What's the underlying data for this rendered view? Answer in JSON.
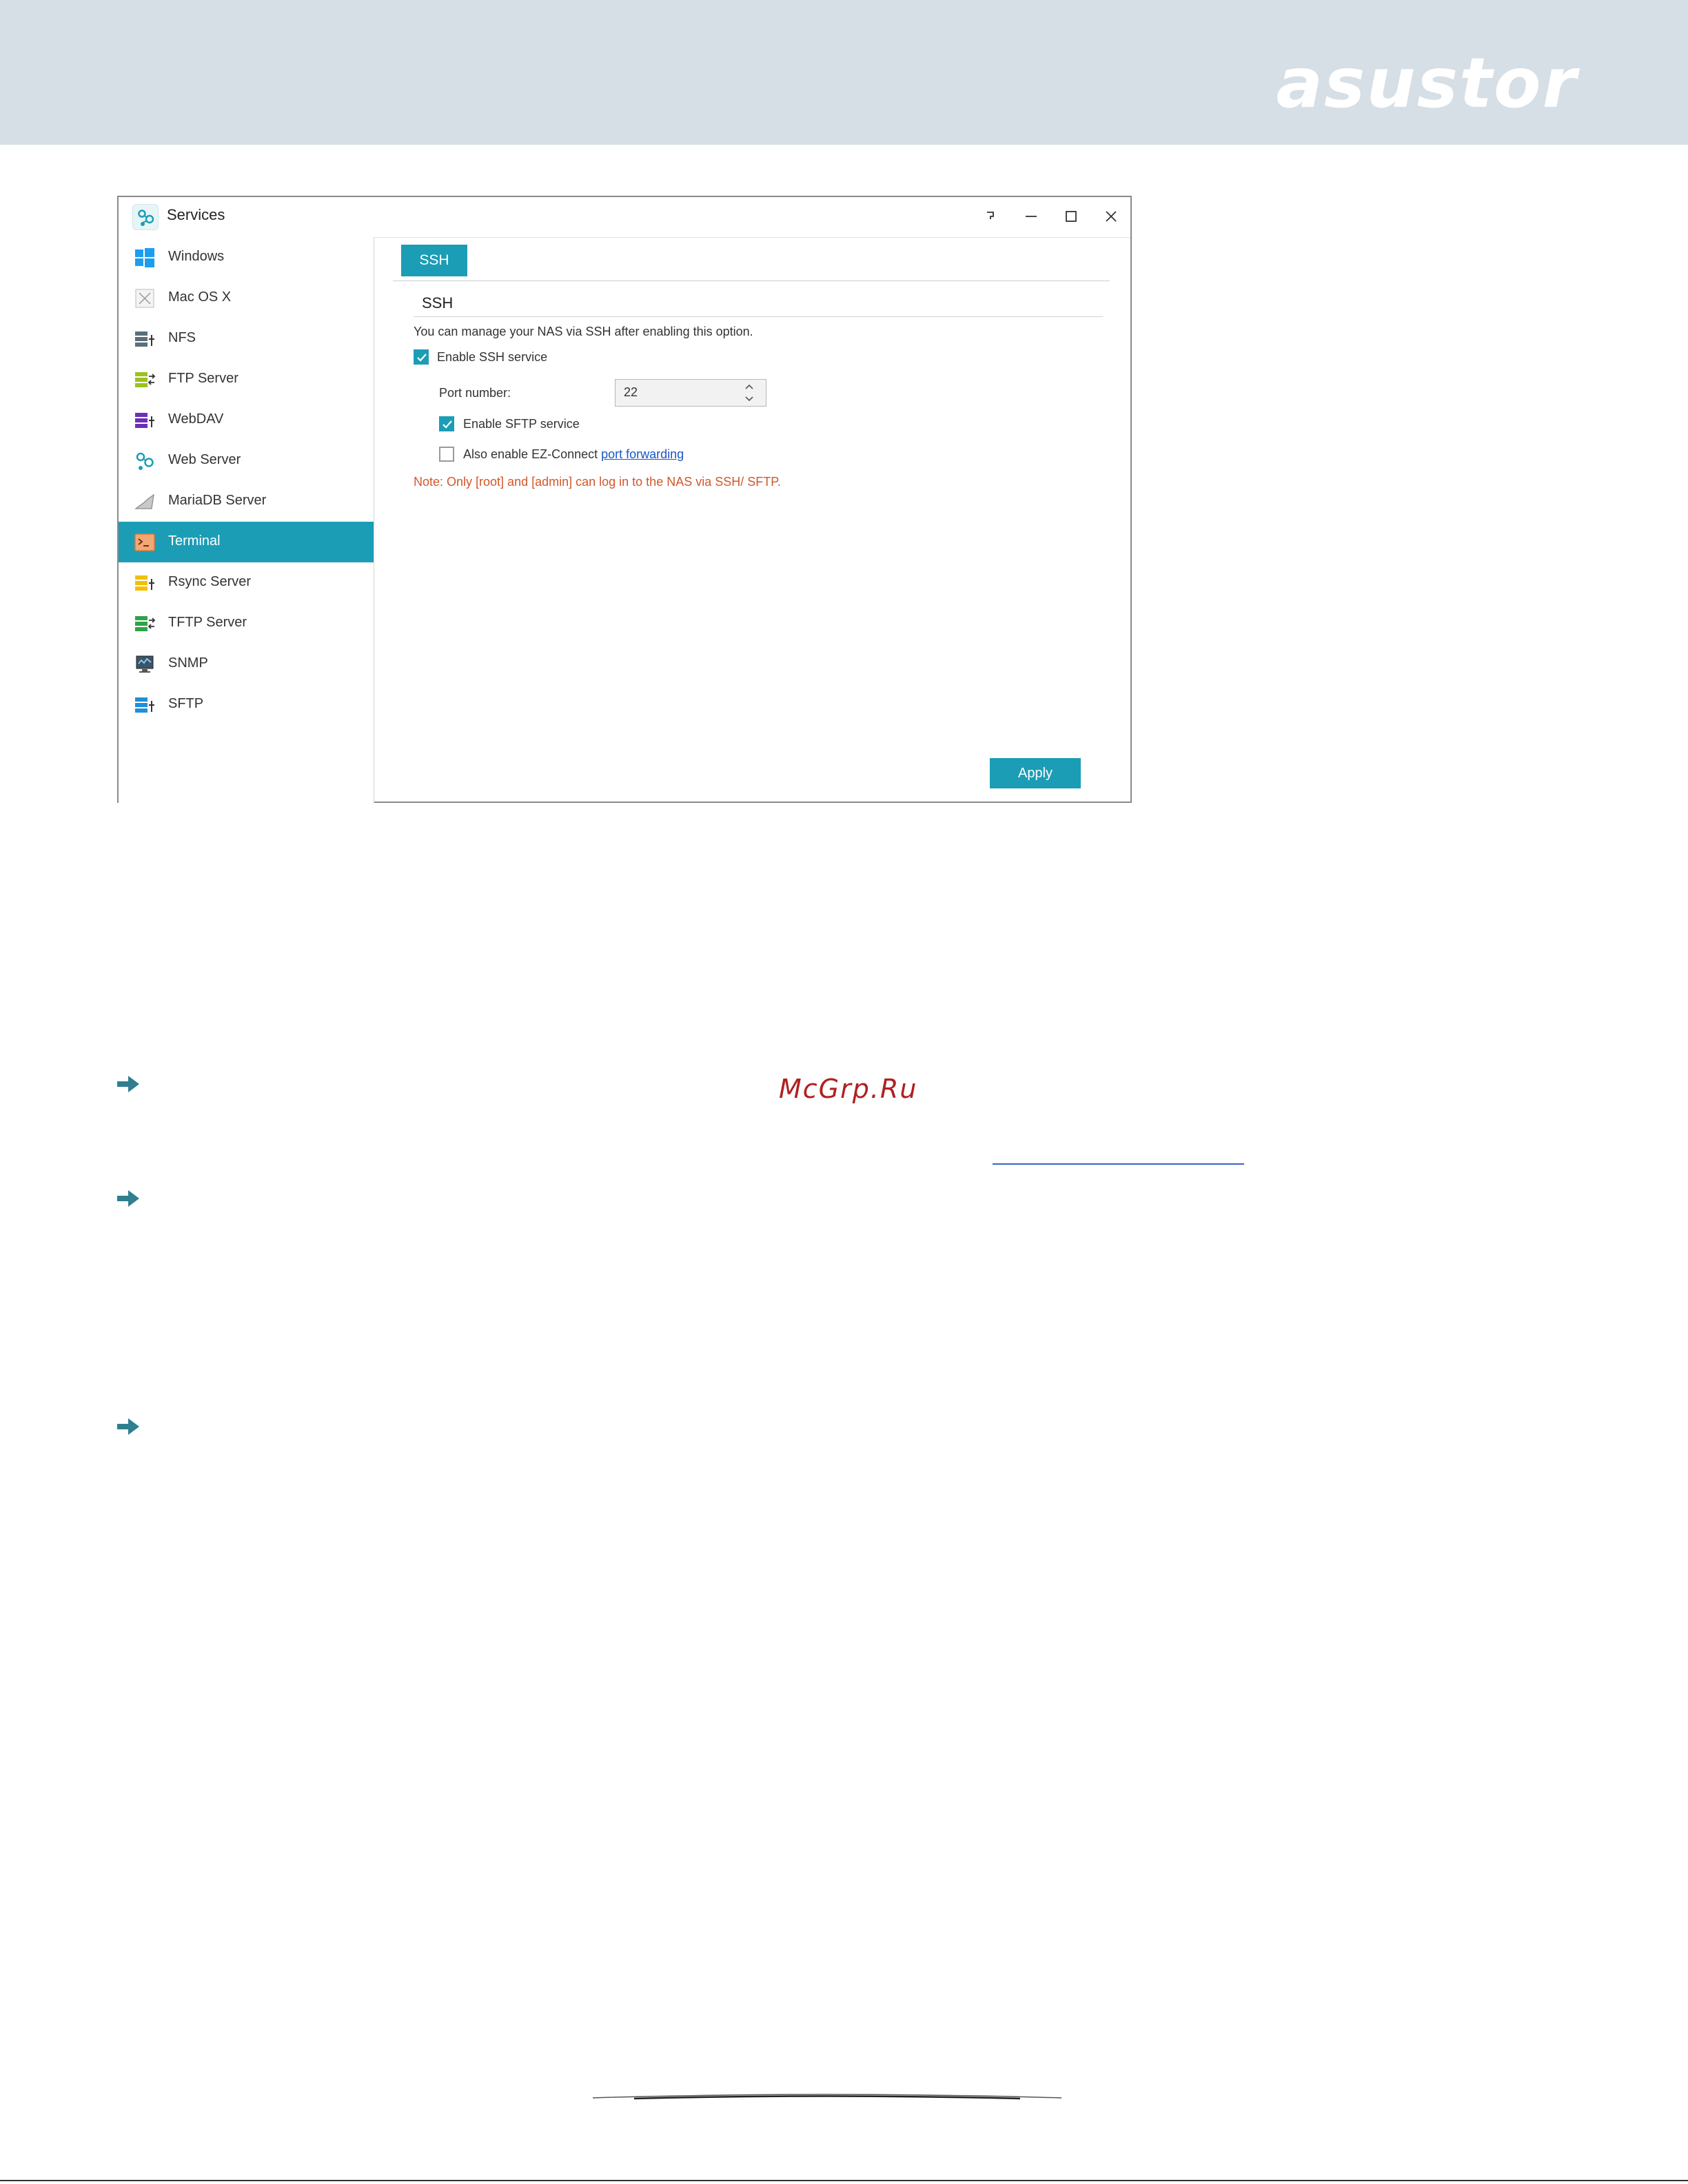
{
  "brand": {
    "logo_text": "asustor"
  },
  "window": {
    "title": "Services",
    "controls": [
      "help-icon",
      "minimize-icon",
      "maximize-icon",
      "close-icon"
    ]
  },
  "sidebar": {
    "items": [
      {
        "label": "Windows",
        "icon": "windows-icon"
      },
      {
        "label": "Mac OS X",
        "icon": "mac-icon"
      },
      {
        "label": "NFS",
        "icon": "nfs-icon"
      },
      {
        "label": "FTP Server",
        "icon": "ftp-server-icon"
      },
      {
        "label": "WebDAV",
        "icon": "webdav-icon"
      },
      {
        "label": "Web Server",
        "icon": "web-server-icon"
      },
      {
        "label": "MariaDB Server",
        "icon": "mariadb-icon"
      },
      {
        "label": "Terminal",
        "icon": "terminal-icon",
        "active": true
      },
      {
        "label": "Rsync Server",
        "icon": "rsync-icon"
      },
      {
        "label": "TFTP Server",
        "icon": "tftp-icon"
      },
      {
        "label": "SNMP",
        "icon": "snmp-icon"
      },
      {
        "label": "SFTP",
        "icon": "sftp-icon"
      }
    ]
  },
  "main": {
    "tab": "SSH",
    "section_title": "SSH",
    "description": "You can manage your NAS via SSH after enabling this option.",
    "enable_ssh": {
      "label": "Enable SSH service",
      "checked": true
    },
    "port": {
      "label": "Port number:",
      "value": "22"
    },
    "enable_sftp": {
      "label": "Enable SFTP service",
      "checked": true
    },
    "ez_connect": {
      "label": "Also enable EZ-Connect",
      "link": "port forwarding",
      "checked": false
    },
    "note": "Note: Only [root] and [admin] can log in to the NAS via SSH/ SFTP.",
    "apply_label": "Apply"
  },
  "page": {
    "watermark": "McGrp.Ru"
  },
  "colors": {
    "accent": "#1c9db6",
    "header_bg": "#d5dfe5",
    "note": "#d2562a",
    "link": "#1a55c6"
  }
}
